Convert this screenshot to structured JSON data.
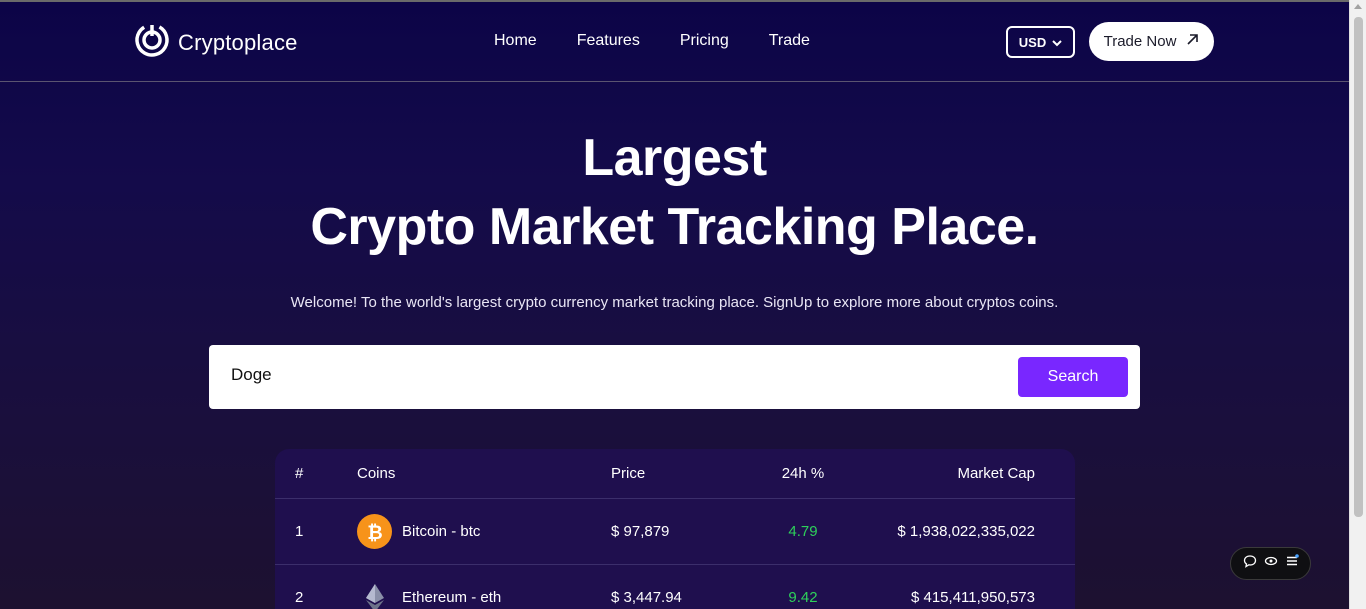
{
  "header": {
    "logo_text": "Cryptoplace",
    "nav": [
      "Home",
      "Features",
      "Pricing",
      "Trade"
    ],
    "currency": "USD",
    "trade_button": "Trade Now"
  },
  "hero": {
    "title_line1": "Largest",
    "title_line2": "Crypto Market Tracking Place.",
    "subtitle": "Welcome! To the world's largest crypto currency market tracking place. SignUp to explore more about cryptos coins."
  },
  "search": {
    "value": "Doge",
    "button": "Search"
  },
  "table": {
    "headers": {
      "num": "#",
      "coins": "Coins",
      "price": "Price",
      "change": "24h %",
      "cap": "Market Cap"
    },
    "rows": [
      {
        "num": "1",
        "coin": "Bitcoin - btc",
        "price": "$ 97,879",
        "change": "4.79",
        "cap": "$ 1,938,022,335,022"
      },
      {
        "num": "2",
        "coin": "Ethereum - eth",
        "price": "$ 3,447.94",
        "change": "9.42",
        "cap": "$ 415,411,950,573"
      }
    ]
  },
  "colors": {
    "accent": "#7927ff",
    "positive": "#2ed05a",
    "bitcoin": "#f7931a"
  },
  "icons": {
    "logo": "cryptoplace-logo-icon",
    "trade": "arrow-up-right-icon",
    "currency": "chevron-down-icon",
    "widget": [
      "chat-bubble-icon",
      "eye-icon",
      "menu-icon"
    ]
  }
}
